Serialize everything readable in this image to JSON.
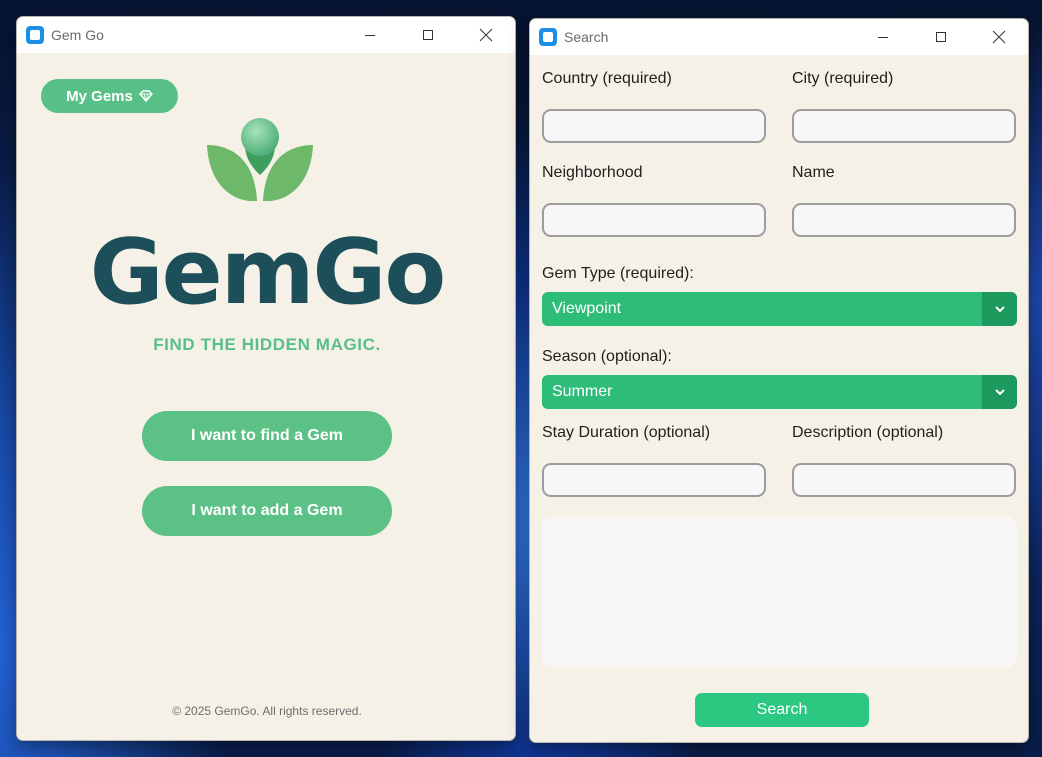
{
  "gemgo_window": {
    "title": "Gem Go",
    "my_gems_label": "My Gems",
    "wordmark": "GemGo",
    "tagline": "FIND THE HIDDEN MAGIC.",
    "find_button": "I want to find a Gem",
    "add_button": "I want to add a Gem",
    "copyright": "© 2025 GemGo. All rights reserved."
  },
  "search_window": {
    "title": "Search",
    "country_label": "Country (required)",
    "country_value": "",
    "city_label": "City (required)",
    "city_value": "",
    "neighborhood_label": "Neighborhood",
    "neighborhood_value": "",
    "name_label": "Name",
    "name_value": "",
    "gem_type_label": "Gem Type (required):",
    "gem_type_value": "Viewpoint",
    "season_label": "Season (optional):",
    "season_value": "Summer",
    "stay_label": "Stay Duration (optional)",
    "stay_value": "",
    "description_label": "Description (optional)",
    "description_value": "",
    "search_button": "Search"
  },
  "colors": {
    "accent_green": "#58c086",
    "select_green": "#2dbd78",
    "wordmark_teal": "#1d4f5b",
    "window_bg": "#f6f1e6"
  },
  "icons": [
    "app-icon",
    "minimize-icon",
    "maximize-icon",
    "close-icon",
    "gem-icon",
    "leaf-logo-icon",
    "chevron-down-icon"
  ]
}
